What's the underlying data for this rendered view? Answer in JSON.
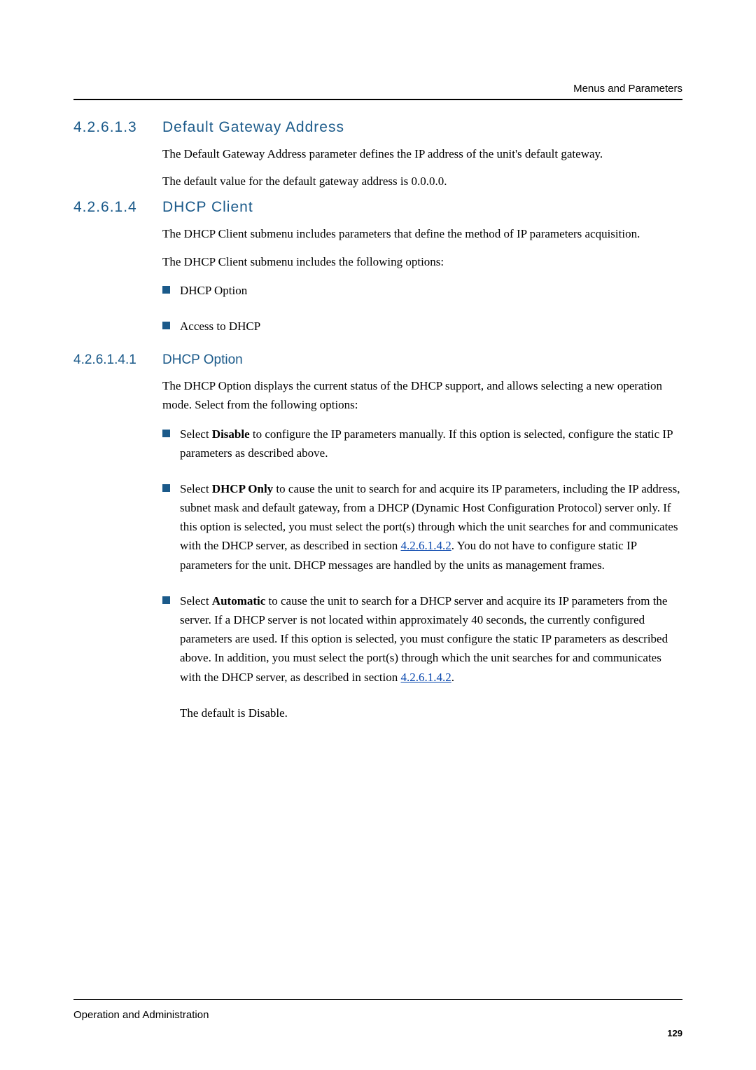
{
  "header": {
    "running_title": "Menus and Parameters"
  },
  "sections": {
    "s1": {
      "num": "4.2.6.1.3",
      "title": "Default Gateway Address"
    },
    "s2": {
      "num": "4.2.6.1.4",
      "title": "DHCP Client"
    },
    "s3": {
      "num": "4.2.6.1.4.1",
      "title": "DHCP Option"
    }
  },
  "paragraphs": {
    "p1": "The Default Gateway Address parameter defines the IP address of the unit's default gateway.",
    "p2": "The default value for the default gateway address is 0.0.0.0.",
    "p3": "The DHCP Client submenu includes parameters that define the method of IP parameters acquisition.",
    "p4": "The DHCP Client submenu includes the following options:",
    "p5": "The DHCP Option displays the current status of the DHCP support, and allows selecting a new operation mode. Select from the following options:",
    "p6": "The default is Disable."
  },
  "list1": {
    "i1": "DHCP Option",
    "i2": "Access to DHCP"
  },
  "list2": {
    "i1_pre": "Select ",
    "i1_bold": "Disable",
    "i1_post": " to configure the IP parameters manually. If this option is selected, configure the static IP parameters as described above.",
    "i2_pre": "Select ",
    "i2_bold": "DHCP Only",
    "i2_mid": " to cause the unit to search for and acquire its IP parameters, including the IP address, subnet mask and default gateway, from a DHCP (Dynamic Host Configuration Protocol) server only. If this option is selected, you must select the port(s) through which the unit searches for and communicates with the DHCP server, as described in section ",
    "i2_xref": "4.2.6.1.4.2",
    "i2_post": ". You do not have to configure static IP parameters for the unit. DHCP messages are handled by the units as management frames.",
    "i3_pre": "Select ",
    "i3_bold": "Automatic",
    "i3_mid": " to cause the unit to search for a DHCP server and acquire its IP parameters from the server. If a DHCP server is not located within approximately 40 seconds, the currently configured parameters are used. If this option is selected, you must configure the static IP parameters as described above. In addition, you must select the port(s) through which the unit searches for and communicates with the DHCP server, as described in section ",
    "i3_xref": "4.2.6.1.4.2",
    "i3_post": "."
  },
  "footer": {
    "section_label": "Operation and Administration",
    "page": "129"
  }
}
